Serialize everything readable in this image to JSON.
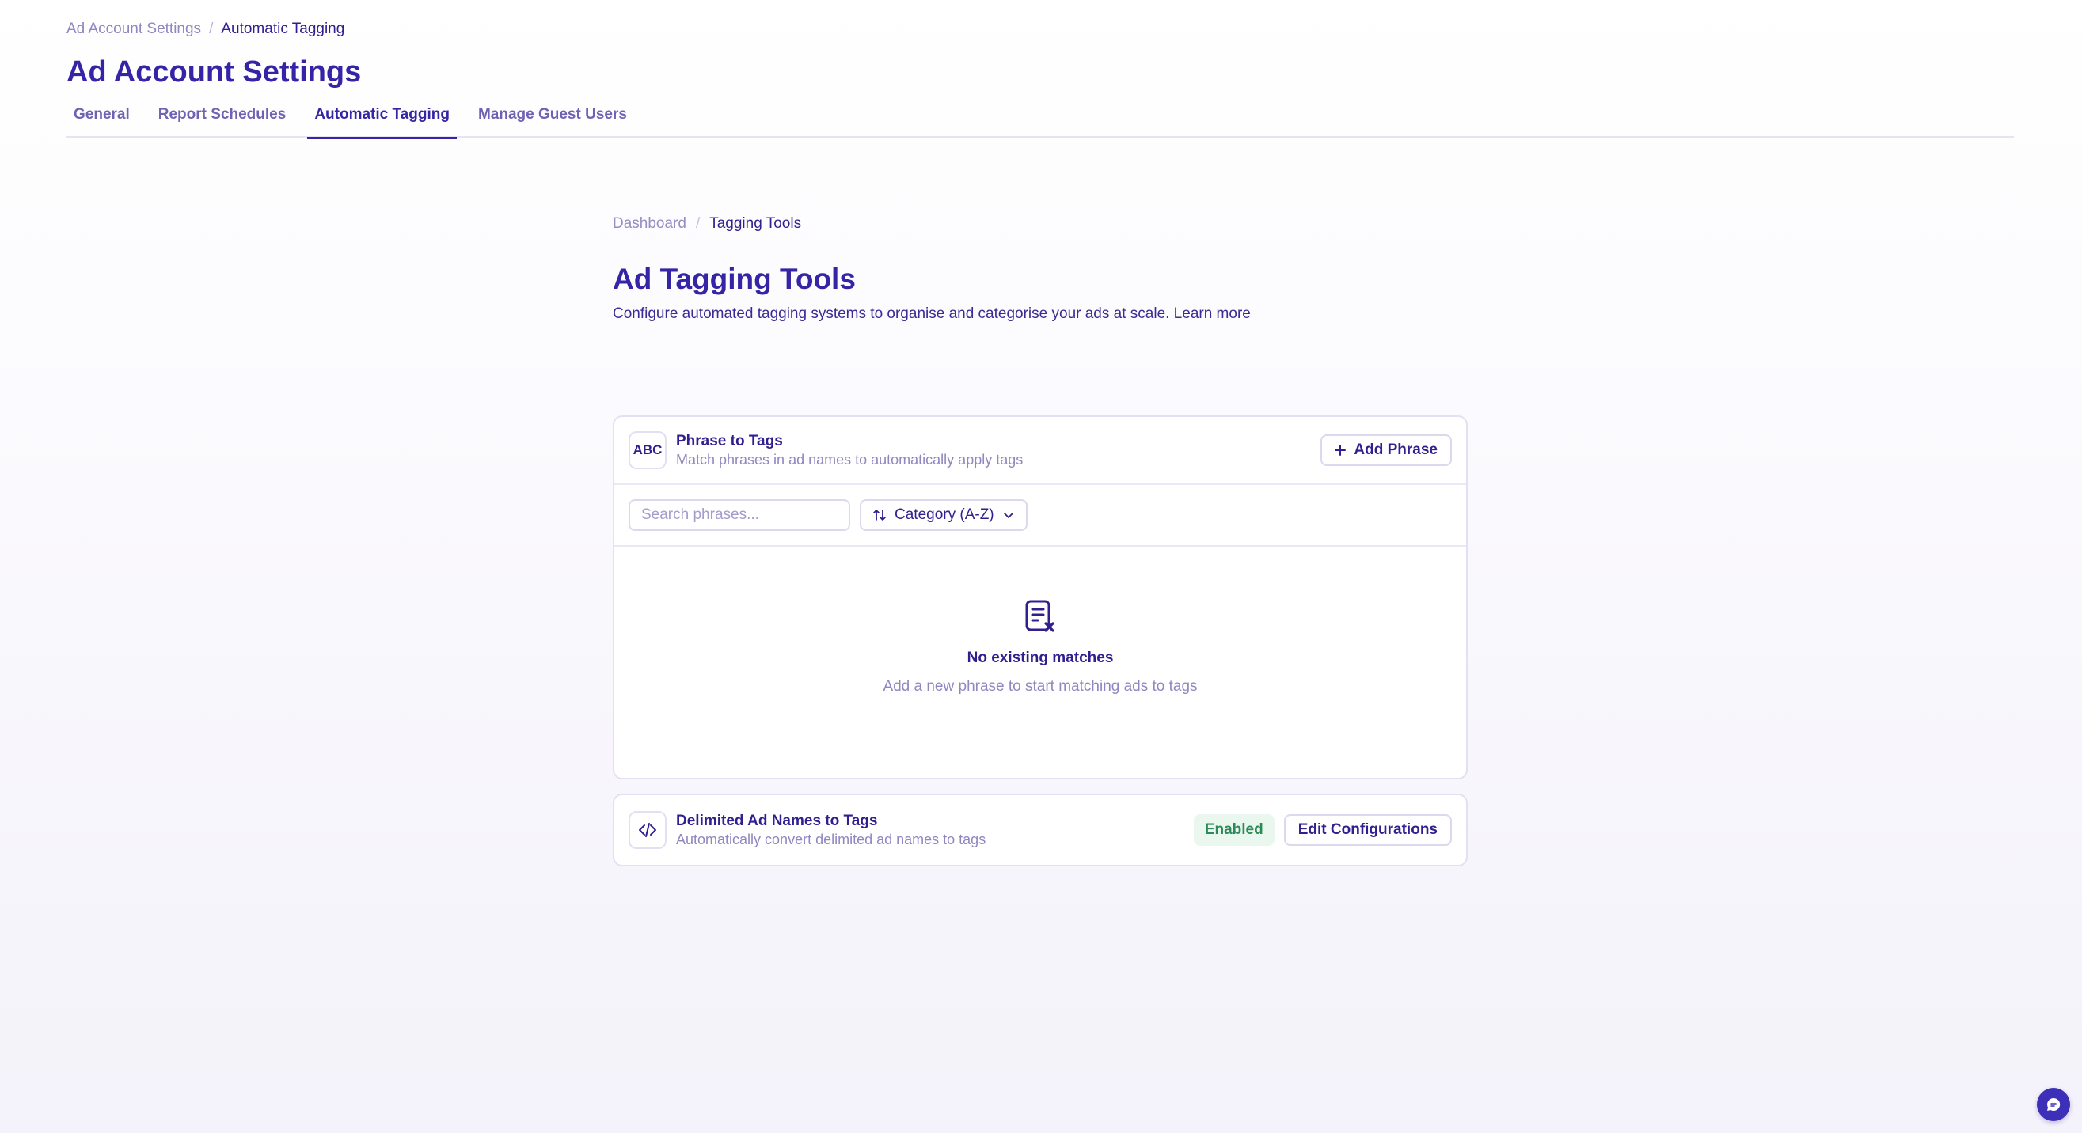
{
  "header": {
    "breadcrumb": {
      "parent": "Ad Account Settings",
      "separator": "/",
      "current": "Automatic Tagging"
    },
    "title": "Ad Account Settings",
    "tabs": [
      {
        "label": "General",
        "active": false
      },
      {
        "label": "Report Schedules",
        "active": false
      },
      {
        "label": "Automatic Tagging",
        "active": true
      },
      {
        "label": "Manage Guest Users",
        "active": false
      }
    ]
  },
  "main": {
    "breadcrumb": {
      "parent": "Dashboard",
      "separator": "/",
      "current": "Tagging Tools"
    },
    "title": "Ad Tagging Tools",
    "subtitle": "Configure automated tagging systems to organise and categorise your ads at scale. Learn more",
    "phrase_card": {
      "icon_text": "ABC",
      "title": "Phrase to Tags",
      "description": "Match phrases in ad names to automatically apply tags",
      "add_button": "Add Phrase",
      "search_placeholder": "Search phrases...",
      "sort_value": "Category (A-Z)",
      "empty_title": "No existing matches",
      "empty_description": "Add a new phrase to start matching ads to tags"
    },
    "delimited_card": {
      "title": "Delimited Ad Names to Tags",
      "description": "Automatically convert delimited ad names to tags",
      "status": "Enabled",
      "edit_button": "Edit Configurations"
    }
  },
  "colors": {
    "primary": "#3524a6",
    "muted_text": "#8f88c0",
    "border": "#e3e0f2",
    "enabled_bg": "#eaf7ef",
    "enabled_text": "#2b8a57"
  }
}
